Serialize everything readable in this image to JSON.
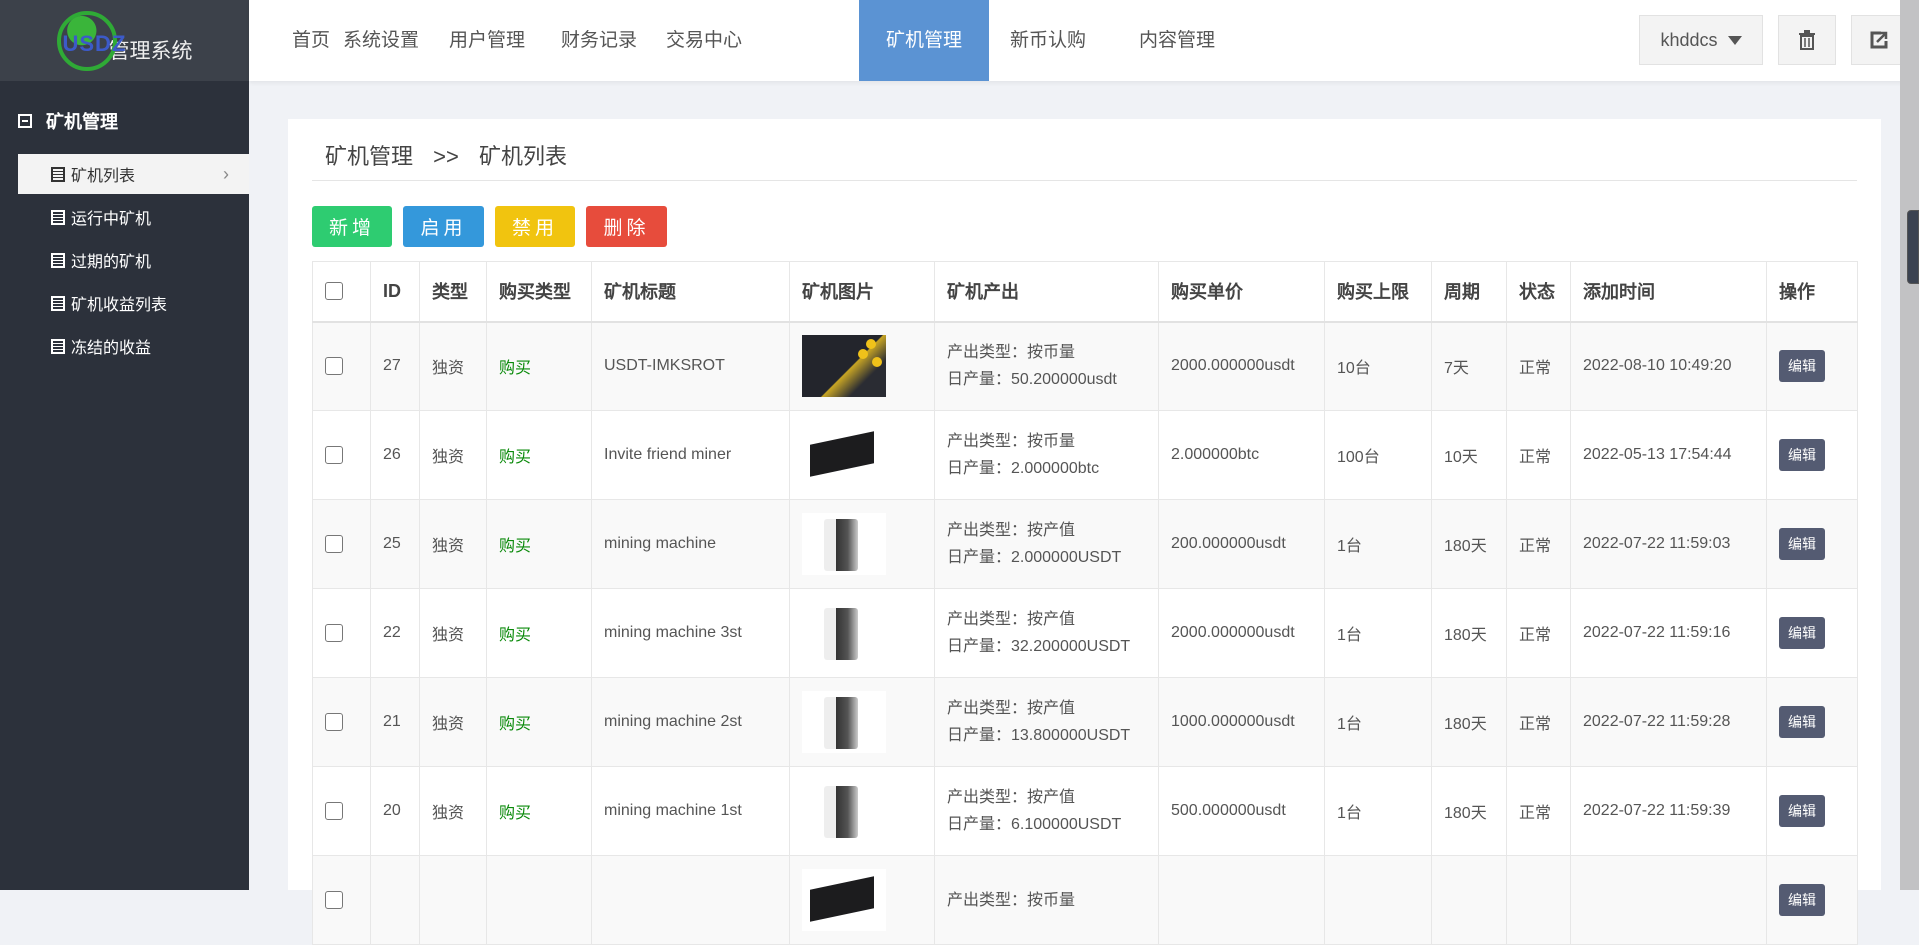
{
  "logo": {
    "brand": "USDZ",
    "title": "管理系统"
  },
  "nav": [
    "首页",
    "系统设置",
    "用户管理",
    "财务记录",
    "交易中心",
    "矿机管理",
    "新币认购",
    "内容管理"
  ],
  "nav_active": 5,
  "user": {
    "name": "khddcs"
  },
  "sidebar": {
    "title": "矿机管理",
    "items": [
      "矿机列表",
      "运行中矿机",
      "过期的矿机",
      "矿机收益列表",
      "冻结的收益"
    ],
    "active": 0
  },
  "breadcrumb": {
    "parent": "矿机管理",
    "sep": ">>",
    "current": "矿机列表"
  },
  "actions": {
    "add": "新增",
    "enable": "启用",
    "disable": "禁用",
    "delete": "删除"
  },
  "colors": {
    "add": "#2ecc71",
    "enable": "#3498db",
    "disable": "#f1c40f",
    "delete": "#e74c3c",
    "nav_active": "#5b93d3"
  },
  "table": {
    "headers": [
      "ID",
      "类型",
      "购买类型",
      "矿机标题",
      "矿机图片",
      "矿机产出",
      "购买单价",
      "购买上限",
      "周期",
      "状态",
      "添加时间",
      "操作"
    ],
    "rows": [
      {
        "id": "27",
        "type": "独资",
        "buy": "购买",
        "title": "USDT-IMKSROT",
        "img": "pool",
        "out_type": "产出类型：按币量",
        "daily": "日产量：50.200000usdt",
        "price": "2000.000000usdt",
        "limit": "10台",
        "period": "7天",
        "status": "正常",
        "time": "2022-08-10 10:49:20",
        "op": "编辑"
      },
      {
        "id": "26",
        "type": "独资",
        "buy": "购买",
        "title": "Invite friend miner",
        "img": "box",
        "out_type": "产出类型：按币量",
        "daily": "日产量：2.000000btc",
        "price": "2.000000btc",
        "limit": "100台",
        "period": "10天",
        "status": "正常",
        "time": "2022-05-13 17:54:44",
        "op": "编辑"
      },
      {
        "id": "25",
        "type": "独资",
        "buy": "购买",
        "title": "mining machine",
        "img": "miner",
        "out_type": "产出类型：按产值",
        "daily": "日产量：2.000000USDT",
        "price": "200.000000usdt",
        "limit": "1台",
        "period": "180天",
        "status": "正常",
        "time": "2022-07-22 11:59:03",
        "op": "编辑"
      },
      {
        "id": "22",
        "type": "独资",
        "buy": "购买",
        "title": "mining machine 3st",
        "img": "miner",
        "out_type": "产出类型：按产值",
        "daily": "日产量：32.200000USDT",
        "price": "2000.000000usdt",
        "limit": "1台",
        "period": "180天",
        "status": "正常",
        "time": "2022-07-22 11:59:16",
        "op": "编辑"
      },
      {
        "id": "21",
        "type": "独资",
        "buy": "购买",
        "title": "mining machine 2st",
        "img": "miner",
        "out_type": "产出类型：按产值",
        "daily": "日产量：13.800000USDT",
        "price": "1000.000000usdt",
        "limit": "1台",
        "period": "180天",
        "status": "正常",
        "time": "2022-07-22 11:59:28",
        "op": "编辑"
      },
      {
        "id": "20",
        "type": "独资",
        "buy": "购买",
        "title": "mining machine 1st",
        "img": "miner",
        "out_type": "产出类型：按产值",
        "daily": "日产量：6.100000USDT",
        "price": "500.000000usdt",
        "limit": "1台",
        "period": "180天",
        "status": "正常",
        "time": "2022-07-22 11:59:39",
        "op": "编辑"
      },
      {
        "img": "box",
        "out_type": "产出类型：按币量",
        "op": "编辑"
      }
    ]
  }
}
